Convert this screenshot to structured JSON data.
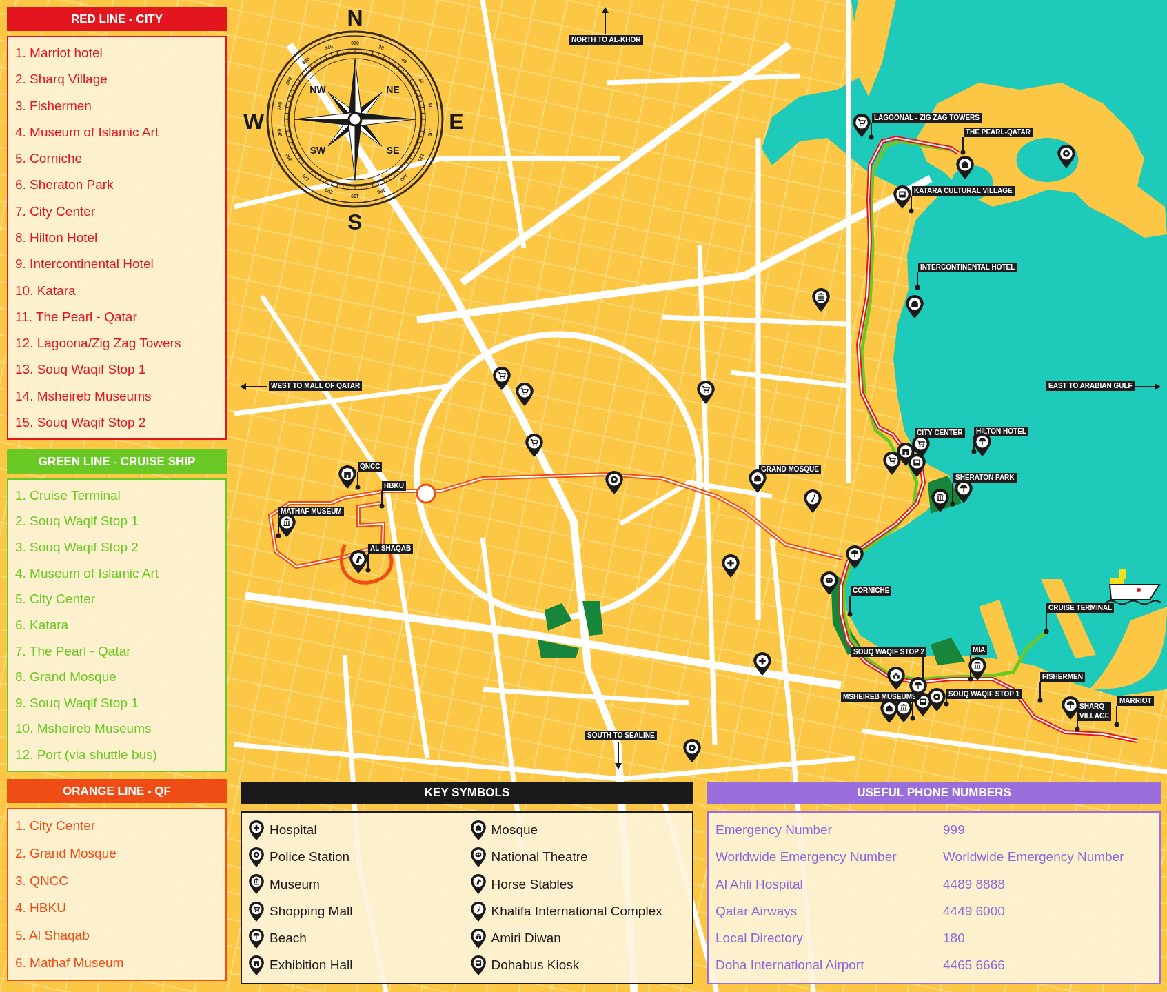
{
  "lines": [
    {
      "title": "RED LINE - CITY",
      "color": "#e3161f",
      "stops": [
        "1. Marriot hotel",
        "2. Sharq Village",
        "3. Fishermen",
        "4. Museum of Islamic Art",
        "5. Corniche",
        "6. Sheraton Park",
        "7. City Center",
        "8. Hilton Hotel",
        "9. Intercontinental Hotel",
        "10. Katara",
        "11. The Pearl - Qatar",
        "12. Lagoona/Zig Zag Towers",
        "13. Souq Waqif Stop 1",
        "14. Msheireb Museums",
        "15. Souq Waqif Stop 2"
      ]
    },
    {
      "title": "GREEN LINE - CRUISE SHIP",
      "color": "#6bc925",
      "stops": [
        "1. Cruise Terminal",
        "2. Souq Waqif Stop 1",
        "3. Souq Waqif Stop 2",
        "4. Museum of Islamic Art",
        "5. City Center",
        "6. Katara",
        "7. The Pearl - Qatar",
        "8. Grand Mosque",
        "9. Souq Waqif Stop 1",
        "10. Msheireb Museums",
        "12. Port (via shuttle bus)"
      ]
    },
    {
      "title": "ORANGE LINE - QF",
      "color": "#f04d16",
      "stops": [
        "1. City Center",
        "2. Grand Mosque",
        "3. QNCC",
        "4. HBKU",
        "5. Al Shaqab",
        "6. Mathaf Museum"
      ]
    }
  ],
  "key_symbols": {
    "title": "KEY SYMBOLS",
    "items": [
      "Hospital",
      "Police Station",
      "Museum",
      "Shopping Mall",
      "Beach",
      "Exhibition Hall",
      "Mosque",
      "National Theatre",
      "Horse Stables",
      "Khalifa International Complex",
      "Amiri Diwan",
      "Dohabus Kiosk"
    ]
  },
  "phone_numbers": {
    "title": "USEFUL PHONE NUMBERS",
    "rows": [
      {
        "name": "Emergency Number",
        "number": "999"
      },
      {
        "name": "Worldwide Emergency Number",
        "number": "Worldwide Emergency Number"
      },
      {
        "name": "Al Ahli Hospital",
        "number": "4489 8888"
      },
      {
        "name": "Qatar Airways",
        "number": "4449 6000"
      },
      {
        "name": "Local Directory",
        "number": "180"
      },
      {
        "name": "Doha International Airport",
        "number": "4465 6666"
      }
    ]
  },
  "map": {
    "compass": {
      "cardinals": [
        "N",
        "E",
        "S",
        "W"
      ],
      "intercardinals": [
        "NW",
        "NE",
        "SW",
        "SE"
      ],
      "degrees": [
        "000",
        "20",
        "40",
        "60",
        "80",
        "100",
        "120",
        "140",
        "160",
        "180",
        "200",
        "220",
        "240",
        "260",
        "280",
        "300",
        "320",
        "340"
      ]
    },
    "directions": [
      "NORTH TO AL-KHOR",
      "WEST TO MALL OF QATAR",
      "EAST TO ARABIAN GULF",
      "SOUTH TO SEALINE"
    ],
    "stop_labels": [
      "LAGOONAL - ZIG ZAG TOWERS",
      "THE PEARL-QATAR",
      "KATARA CULTURAL VILLAGE",
      "INTERCONTINENTAL HOTEL",
      "CITY CENTER",
      "HILTON HOTEL",
      "SHERATON PARK",
      "GRAND MOSQUE",
      "CORNICHE",
      "CRUISE TERMINAL",
      "SOUQ WAQIF STOP 2",
      "MIA",
      "FISHERMEN",
      "MSHEIREB MUSEUMS",
      "SOUQ WAQIF STOP 1",
      "SHARQ VILLAGE",
      "MARRIOT",
      "QNCC",
      "HBKU",
      "MATHAF MUSEUM",
      "AL SHAQAB"
    ]
  }
}
